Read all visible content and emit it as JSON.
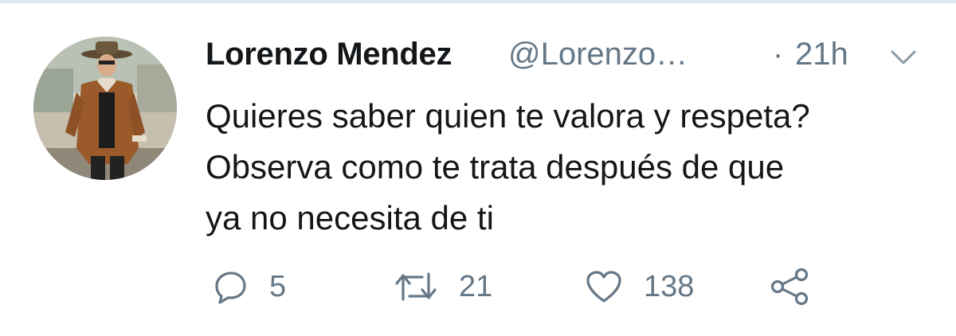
{
  "tweet": {
    "display_name": "Lorenzo Mendez",
    "handle": "@Lorenzo…",
    "separator": "·",
    "time": "21h",
    "text_lines": [
      "Quieres saber quien te valora y respeta?",
      "Observa como te trata después de que",
      "ya no necesita de ti"
    ],
    "actions": {
      "reply_count": "5",
      "retweet_count": "21",
      "like_count": "138"
    }
  },
  "icons": {
    "reply": "reply-icon",
    "retweet": "retweet-icon",
    "like": "heart-icon",
    "share": "share-icon",
    "menu": "chevron-down-icon"
  },
  "colors": {
    "text": "#14171a",
    "secondary": "#657786",
    "border": "#e1e8ed"
  }
}
